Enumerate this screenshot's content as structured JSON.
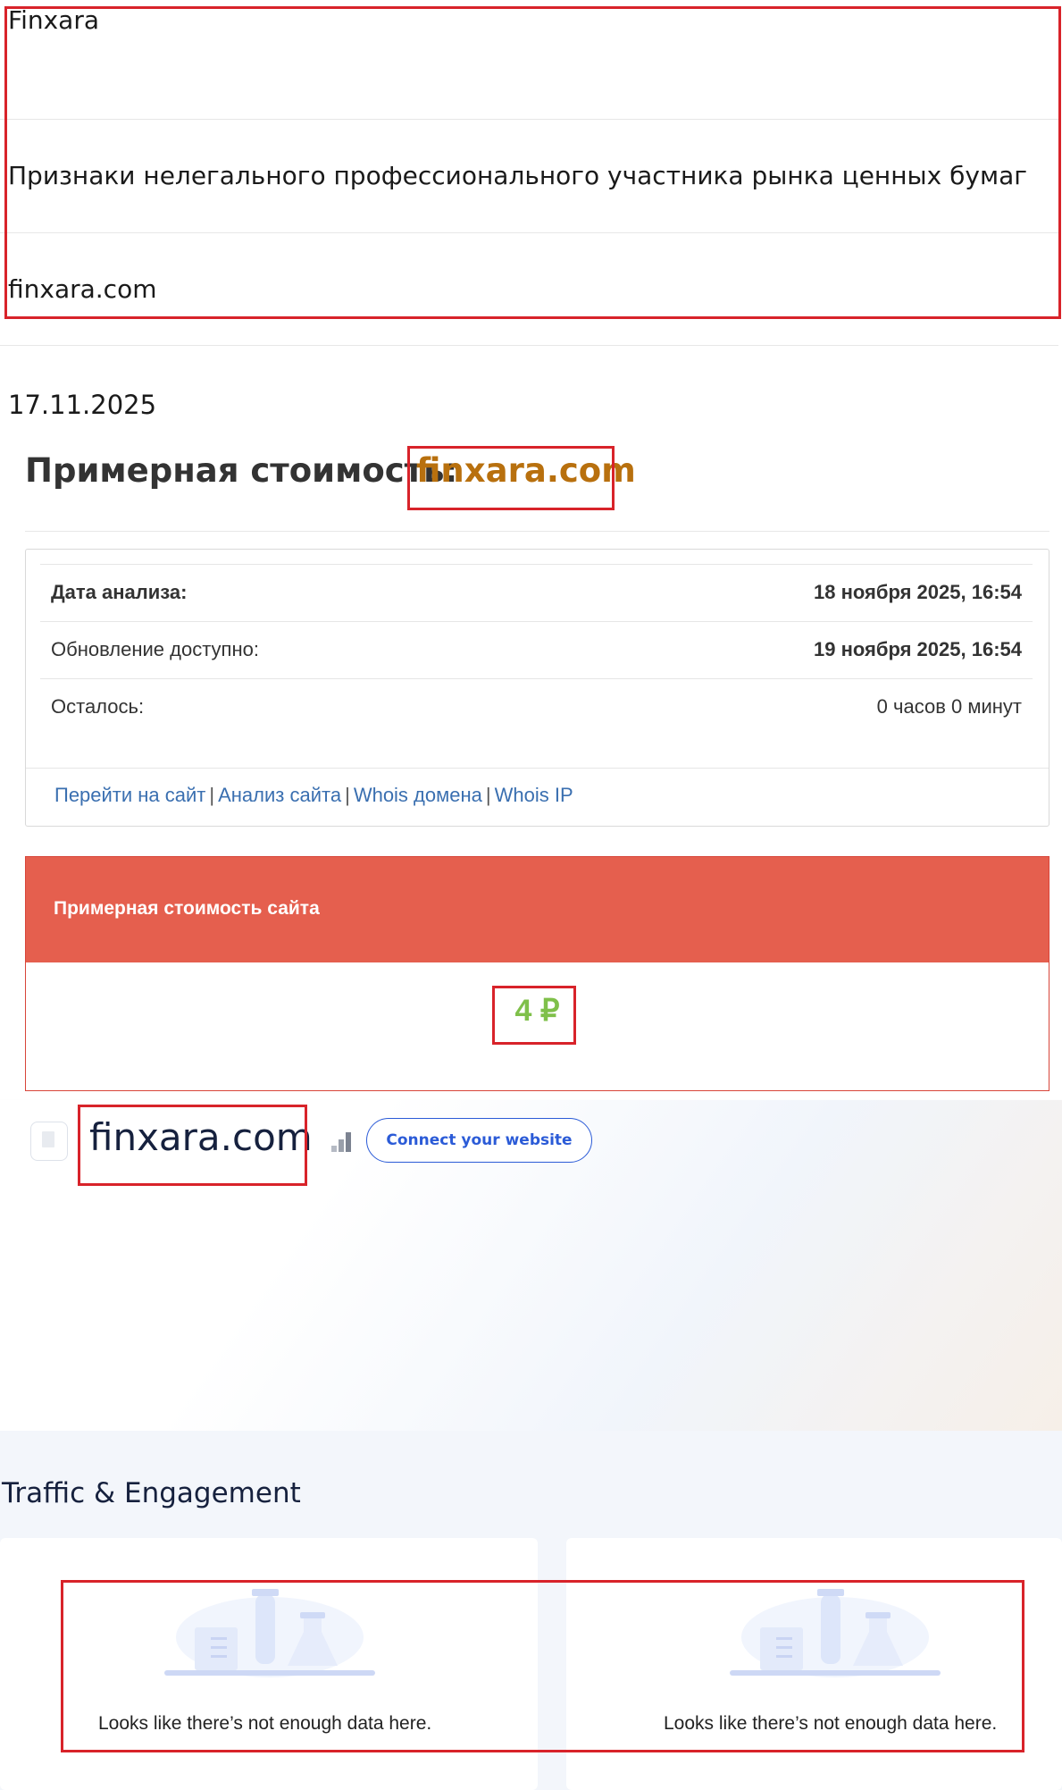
{
  "record": {
    "name": "Finxara",
    "category": "Признаки нелегального профессионального участника рынка ценных бумаг",
    "domain": "finxara.com",
    "date": "17.11.2025"
  },
  "cost": {
    "title": "Примерная стоимость:",
    "domain": "finxara.com",
    "rows": [
      {
        "label": "Дата анализа:",
        "value": "18 ноября 2025, 16:54"
      },
      {
        "label": "Обновление доступно:",
        "value": "19 ноября 2025, 16:54"
      },
      {
        "label": "Осталось:",
        "value": "0 часов 0 минут"
      }
    ],
    "links": [
      "Перейти на сайт",
      "Анализ сайта",
      "Whois домена",
      "Whois IP"
    ],
    "estimate_header": "Примерная стоимость сайта",
    "estimate_value": "4 ₽"
  },
  "similarweb": {
    "domain": "finxara.com",
    "connect_label": "Connect your website",
    "icons": [
      "document-icon",
      "rank-bars-icon"
    ]
  },
  "traffic": {
    "title": "Traffic & Engagement",
    "cards": [
      {
        "message": "Looks like there’s not enough data here."
      },
      {
        "message": "Looks like there’s not enough data here."
      }
    ]
  },
  "colors": {
    "highlight_box": "#d8232a",
    "domain_accent": "#b8700e",
    "estimate_header": "#e55f4e",
    "estimate_value": "#7fc04a",
    "link": "#3a6fb0",
    "connect_button": "#2b5bd7"
  }
}
